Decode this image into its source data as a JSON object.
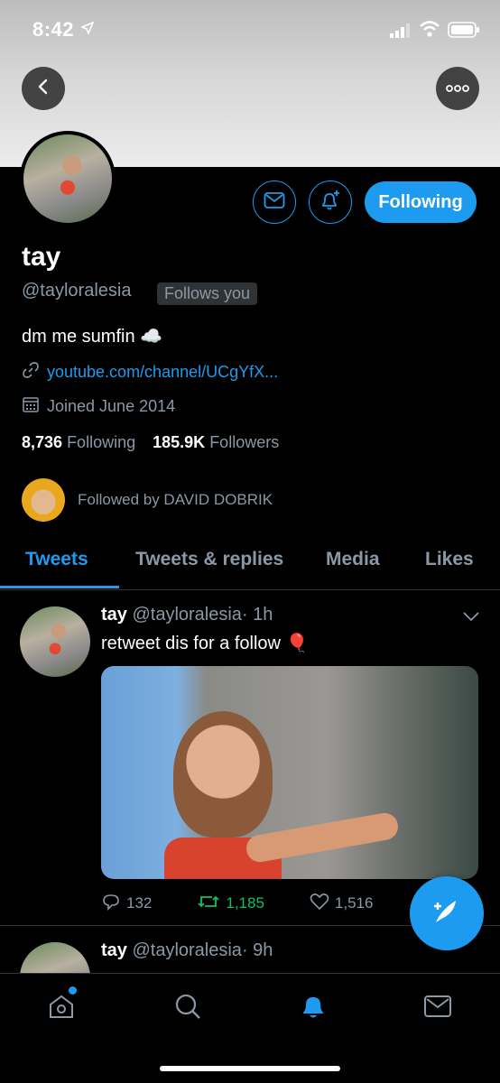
{
  "status_bar": {
    "time": "8:42"
  },
  "profile": {
    "name": "tay",
    "handle": "@tayloralesia",
    "follows_you": "Follows you",
    "bio": "dm me sumfin ☁️",
    "link": "youtube.com/channel/UCgYfX...",
    "joined": "Joined June 2014",
    "following_count": "8,736",
    "following_label": "Following",
    "followers_count": "185.9K",
    "followers_label": "Followers",
    "followed_by": "Followed by DAVID DOBRIK",
    "follow_button": "Following"
  },
  "tabs": [
    {
      "label": "Tweets"
    },
    {
      "label": "Tweets & replies"
    },
    {
      "label": "Media"
    },
    {
      "label": "Likes"
    }
  ],
  "tweets": [
    {
      "name": "tay",
      "handle": "@tayloralesia",
      "time": "· 1h",
      "text": "retweet dis for a follow 🎈",
      "replies": "132",
      "retweets": "1,185",
      "likes": "1,516"
    },
    {
      "name": "tay",
      "handle": "@tayloralesia",
      "time": "· 9h"
    }
  ],
  "colors": {
    "accent": "#1d9bf0",
    "retweet": "#17bf63",
    "muted": "#8b98a5"
  },
  "icons": [
    "location-arrow-icon",
    "signal-icon",
    "wifi-icon",
    "battery-icon",
    "back-arrow-icon",
    "more-dots-icon",
    "mail-icon",
    "bell-plus-icon",
    "link-icon",
    "calendar-icon",
    "chevron-down-icon",
    "reply-icon",
    "retweet-icon",
    "heart-icon",
    "share-icon",
    "compose-icon",
    "home-icon",
    "search-icon",
    "bell-icon",
    "mail-nav-icon"
  ]
}
